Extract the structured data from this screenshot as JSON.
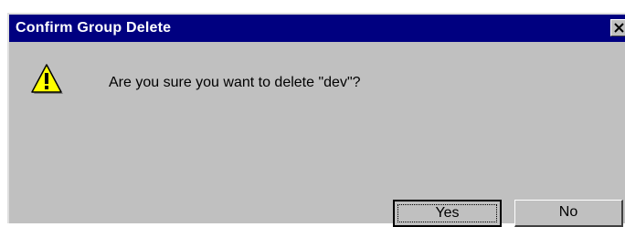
{
  "window": {
    "title": "Confirm Group Delete"
  },
  "dialog": {
    "icon": "warning-icon",
    "message": "Are you sure you want to delete \"dev\"?"
  },
  "buttons": {
    "yes_label": "Yes",
    "no_label": "No"
  },
  "colors": {
    "titlebar": "#000080",
    "dialog_background": "#c0c0c0",
    "warning_fill": "#ffff00"
  }
}
